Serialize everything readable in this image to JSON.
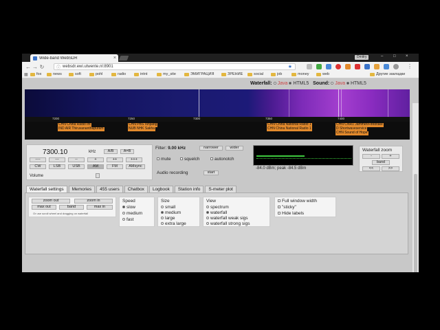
{
  "browser": {
    "tab_title": "Wide-band WebSDR",
    "profile": "Dmitry",
    "url": "websdr.ewi.utwente.nl:8901",
    "bookmarks": [
      "fox",
      "news",
      "soft",
      "pohl",
      "radio",
      "intnt",
      "my_site",
      "ЭМИГРАЦИЯ",
      "ЗРЕНИЕ",
      "social",
      "job",
      "money",
      "web",
      "Другие закладки"
    ]
  },
  "colors": {
    "station_label": "#e38a2c",
    "waterfall_accent": "#a43fcf",
    "smeter_trace": "#3ec93e"
  },
  "waterfall": {
    "toggles": {
      "waterfall_label": "Waterfall:",
      "sound_label": "Sound:",
      "java": "Java",
      "html5": "HTML5"
    },
    "scale_ticks": [
      "7200",
      "7250",
      "7300",
      "7350",
      "7400"
    ],
    "stations": [
      "CHN China Radio Int",
      "IND AIR Thiruvananthapuram",
      "CHN PBS Xinjiang",
      "NUB NHK Sakha",
      "CHN China National Radio 1",
      "CHN China National Radio 1",
      "CHN CNR1 Jammer/Firedrake",
      "D Shortwaveservice",
      "CHN Sound of Hope"
    ]
  },
  "tuning": {
    "frequency": "7300.10",
    "unit": "kHz",
    "ab": [
      "A/B",
      "A=B"
    ],
    "step_buttons": [
      "----",
      "---",
      "--",
      "+",
      "++",
      "+++"
    ],
    "modes": [
      "CW",
      "LSB",
      "USB",
      "AM",
      "FM",
      "AMsync"
    ],
    "active_mode": "AM",
    "volume_label": "Volume"
  },
  "filter": {
    "label": "Filter:",
    "value": "9.00 kHz",
    "narrower": "narrower",
    "wider": "wider",
    "toggles": [
      "mute",
      "squelch",
      "autonotch"
    ],
    "recording_label": "Audio recording",
    "start": "start"
  },
  "smeter": {
    "readout": "-84.0 dBm; peak  -84.5 dBm"
  },
  "zoom": {
    "title": "Waterfall zoom",
    "minus": "-",
    "plus": "+",
    "band": "band",
    "left": "<<",
    "right": ">>"
  },
  "panel_tabs": [
    "Waterfall settings",
    "Memories",
    "455 users",
    "Chatbox",
    "Logbook",
    "Station info",
    "S-meter plot"
  ],
  "settings": {
    "zoom_buttons": [
      "zoom out",
      "zoom in",
      "max out",
      "band",
      "max in"
    ],
    "hint": "Or use scroll wheel and dragging on waterfall",
    "speed": {
      "title": "Speed",
      "options": [
        "slow",
        "medium",
        "fast"
      ],
      "selected": "slow"
    },
    "size": {
      "title": "Size",
      "options": [
        "small",
        "medium",
        "large",
        "extra large"
      ],
      "selected": "medium"
    },
    "view": {
      "title": "View",
      "options": [
        "spectrum",
        "waterfall",
        "waterfall weak sigs",
        "waterfall strong sigs"
      ],
      "selected": "waterfall"
    },
    "checks": [
      "Full window width",
      "\"sticky\"",
      "Hide labels"
    ]
  }
}
